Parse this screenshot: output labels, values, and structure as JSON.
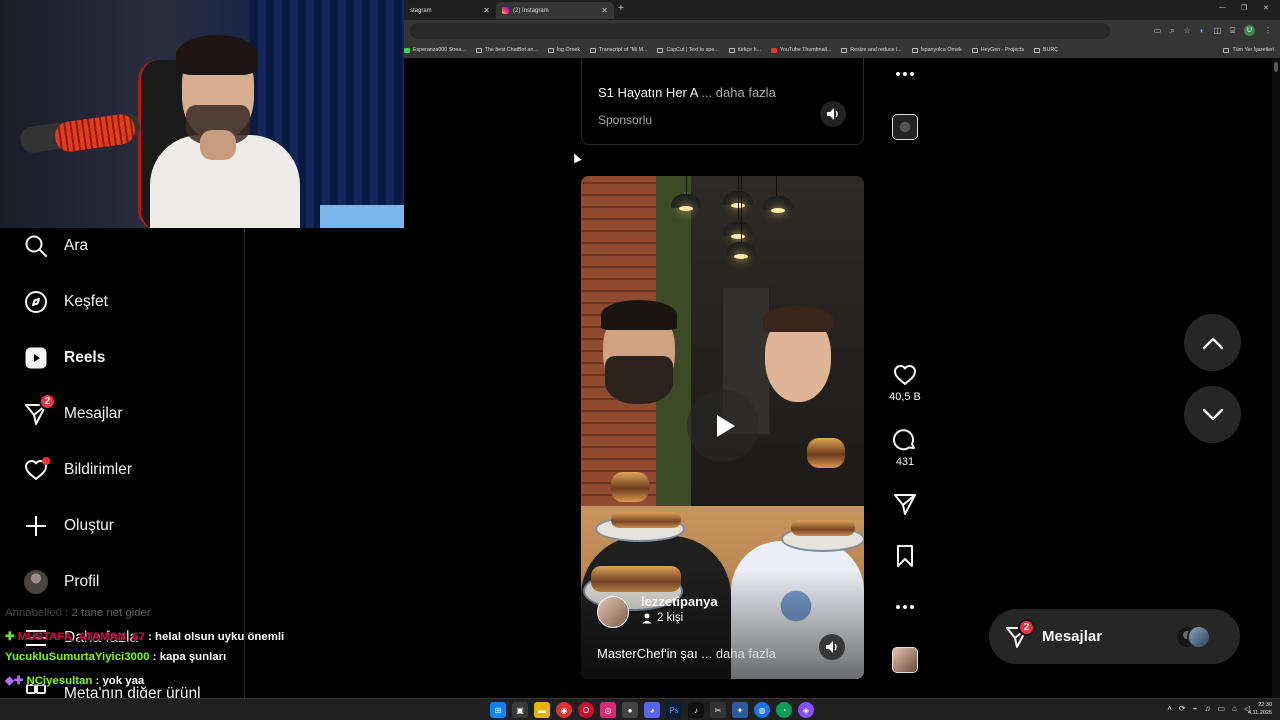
{
  "browser": {
    "tabs": [
      {
        "title": "stagram",
        "active": false
      },
      {
        "title": "(2) Instagram",
        "active": true
      }
    ],
    "bookmarks": [
      "Esperanza000 Strea...",
      "The best ChatBot an...",
      "İng Örnek",
      "Transcript of \"Mi M...",
      "CapCut | Text to spe...",
      "türkçe h...",
      "YouTube Thumbnail...",
      "Resize and reduce i...",
      "İspanyolca Örnek",
      "HeyGen - Projects",
      "BURÇ"
    ],
    "bookmarks_right": "Tüm Yer İşaretleri",
    "profile_initial": "U"
  },
  "sidebar": {
    "items": [
      {
        "label": "Ara",
        "icon": "search-icon"
      },
      {
        "label": "Keşfet",
        "icon": "compass-icon"
      },
      {
        "label": "Reels",
        "icon": "reels-icon",
        "active": true
      },
      {
        "label": "Mesajlar",
        "icon": "messenger-icon",
        "badge": "2"
      },
      {
        "label": "Bildirimler",
        "icon": "heart-icon",
        "dot": true
      },
      {
        "label": "Oluştur",
        "icon": "plus-icon"
      },
      {
        "label": "Profil",
        "icon": "avatar"
      },
      {
        "label": "Daha fazla",
        "icon": "menu-icon"
      },
      {
        "label": "Meta'nın diğer ürünl",
        "icon": "meta-icon"
      }
    ]
  },
  "chat": [
    {
      "user": "Annabelle0",
      "msg": "2 tane net gider",
      "color": "#bdbdbd",
      "faded": true
    },
    {
      "user": "MUSTAFA_ATAMAN_67",
      "msg": "helal olsun uyku önemli",
      "color": "#e0004b",
      "badge": "✚"
    },
    {
      "user": "YucukluSumurtaYiyici3000",
      "msg": "kapa şunları",
      "color": "#7cfc00"
    },
    {
      "user": "NCiyesultan",
      "msg": "yok yaa",
      "color": "#7cfc00",
      "badge": "◆✚"
    }
  ],
  "feed": {
    "top_card": {
      "caption": "S1 Hayatın Her A",
      "more": "... daha fazla",
      "sponsored": "Sponsorlu"
    },
    "reel": {
      "author": "lezzetipanya",
      "collab": "2 kişi",
      "caption": "MasterChef'in şaı",
      "more": "... daha fazla"
    },
    "actions": {
      "likes": "40,5 B",
      "comments": "431"
    }
  },
  "messages_pill": {
    "label": "Mesajlar",
    "badge": "2"
  },
  "taskbar": {
    "time": "22:30",
    "date": "4.11.2025"
  },
  "colors": {
    "background": "#000000",
    "badge": "#ff3040",
    "pill": "#262626",
    "muted": "#a8a8a8"
  }
}
